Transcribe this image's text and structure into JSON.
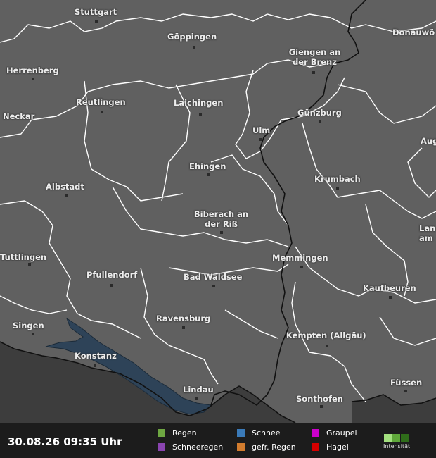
{
  "map": {
    "cities": [
      {
        "name": "Stuttgart"
      },
      {
        "name": "Göppingen"
      },
      {
        "name": "Donauwö"
      },
      {
        "name": "Giengen an der Brenz"
      },
      {
        "name": "Herrenberg"
      },
      {
        "name": "Reutlingen"
      },
      {
        "name": "Laichingen"
      },
      {
        "name": "Neckar"
      },
      {
        "name": "Ulm"
      },
      {
        "name": "Günzburg"
      },
      {
        "name": "Aug"
      },
      {
        "name": "Ehingen"
      },
      {
        "name": "Krumbach"
      },
      {
        "name": "Albstadt"
      },
      {
        "name": "Biberach an der Riß"
      },
      {
        "name": "Lan am"
      },
      {
        "name": "Tuttlingen"
      },
      {
        "name": "Memmingen"
      },
      {
        "name": "Pfullendorf"
      },
      {
        "name": "Bad Waldsee"
      },
      {
        "name": "Kaufbeuren"
      },
      {
        "name": "Ravensburg"
      },
      {
        "name": "Singen"
      },
      {
        "name": "Kempten (Allgäu)"
      },
      {
        "name": "Konstanz"
      },
      {
        "name": "Lindau"
      },
      {
        "name": "Füssen"
      },
      {
        "name": "Sonthofen"
      }
    ]
  },
  "footer": {
    "timestamp": "30.08.26 09:35 Uhr",
    "legend": [
      {
        "label": "Regen",
        "color": "#6ea742"
      },
      {
        "label": "Schneeregen",
        "color": "#8a44b0"
      },
      {
        "label": "Schnee",
        "color": "#3a7ab8"
      },
      {
        "label": "gefr. Regen",
        "color": "#d27c2e"
      },
      {
        "label": "Graupel",
        "color": "#cc00cc"
      },
      {
        "label": "Hagel",
        "color": "#d40000"
      }
    ],
    "intensity_label": "Intensität",
    "intensity_colors": [
      "#a3e07f",
      "#5fa83a",
      "#2f6d1a"
    ]
  }
}
